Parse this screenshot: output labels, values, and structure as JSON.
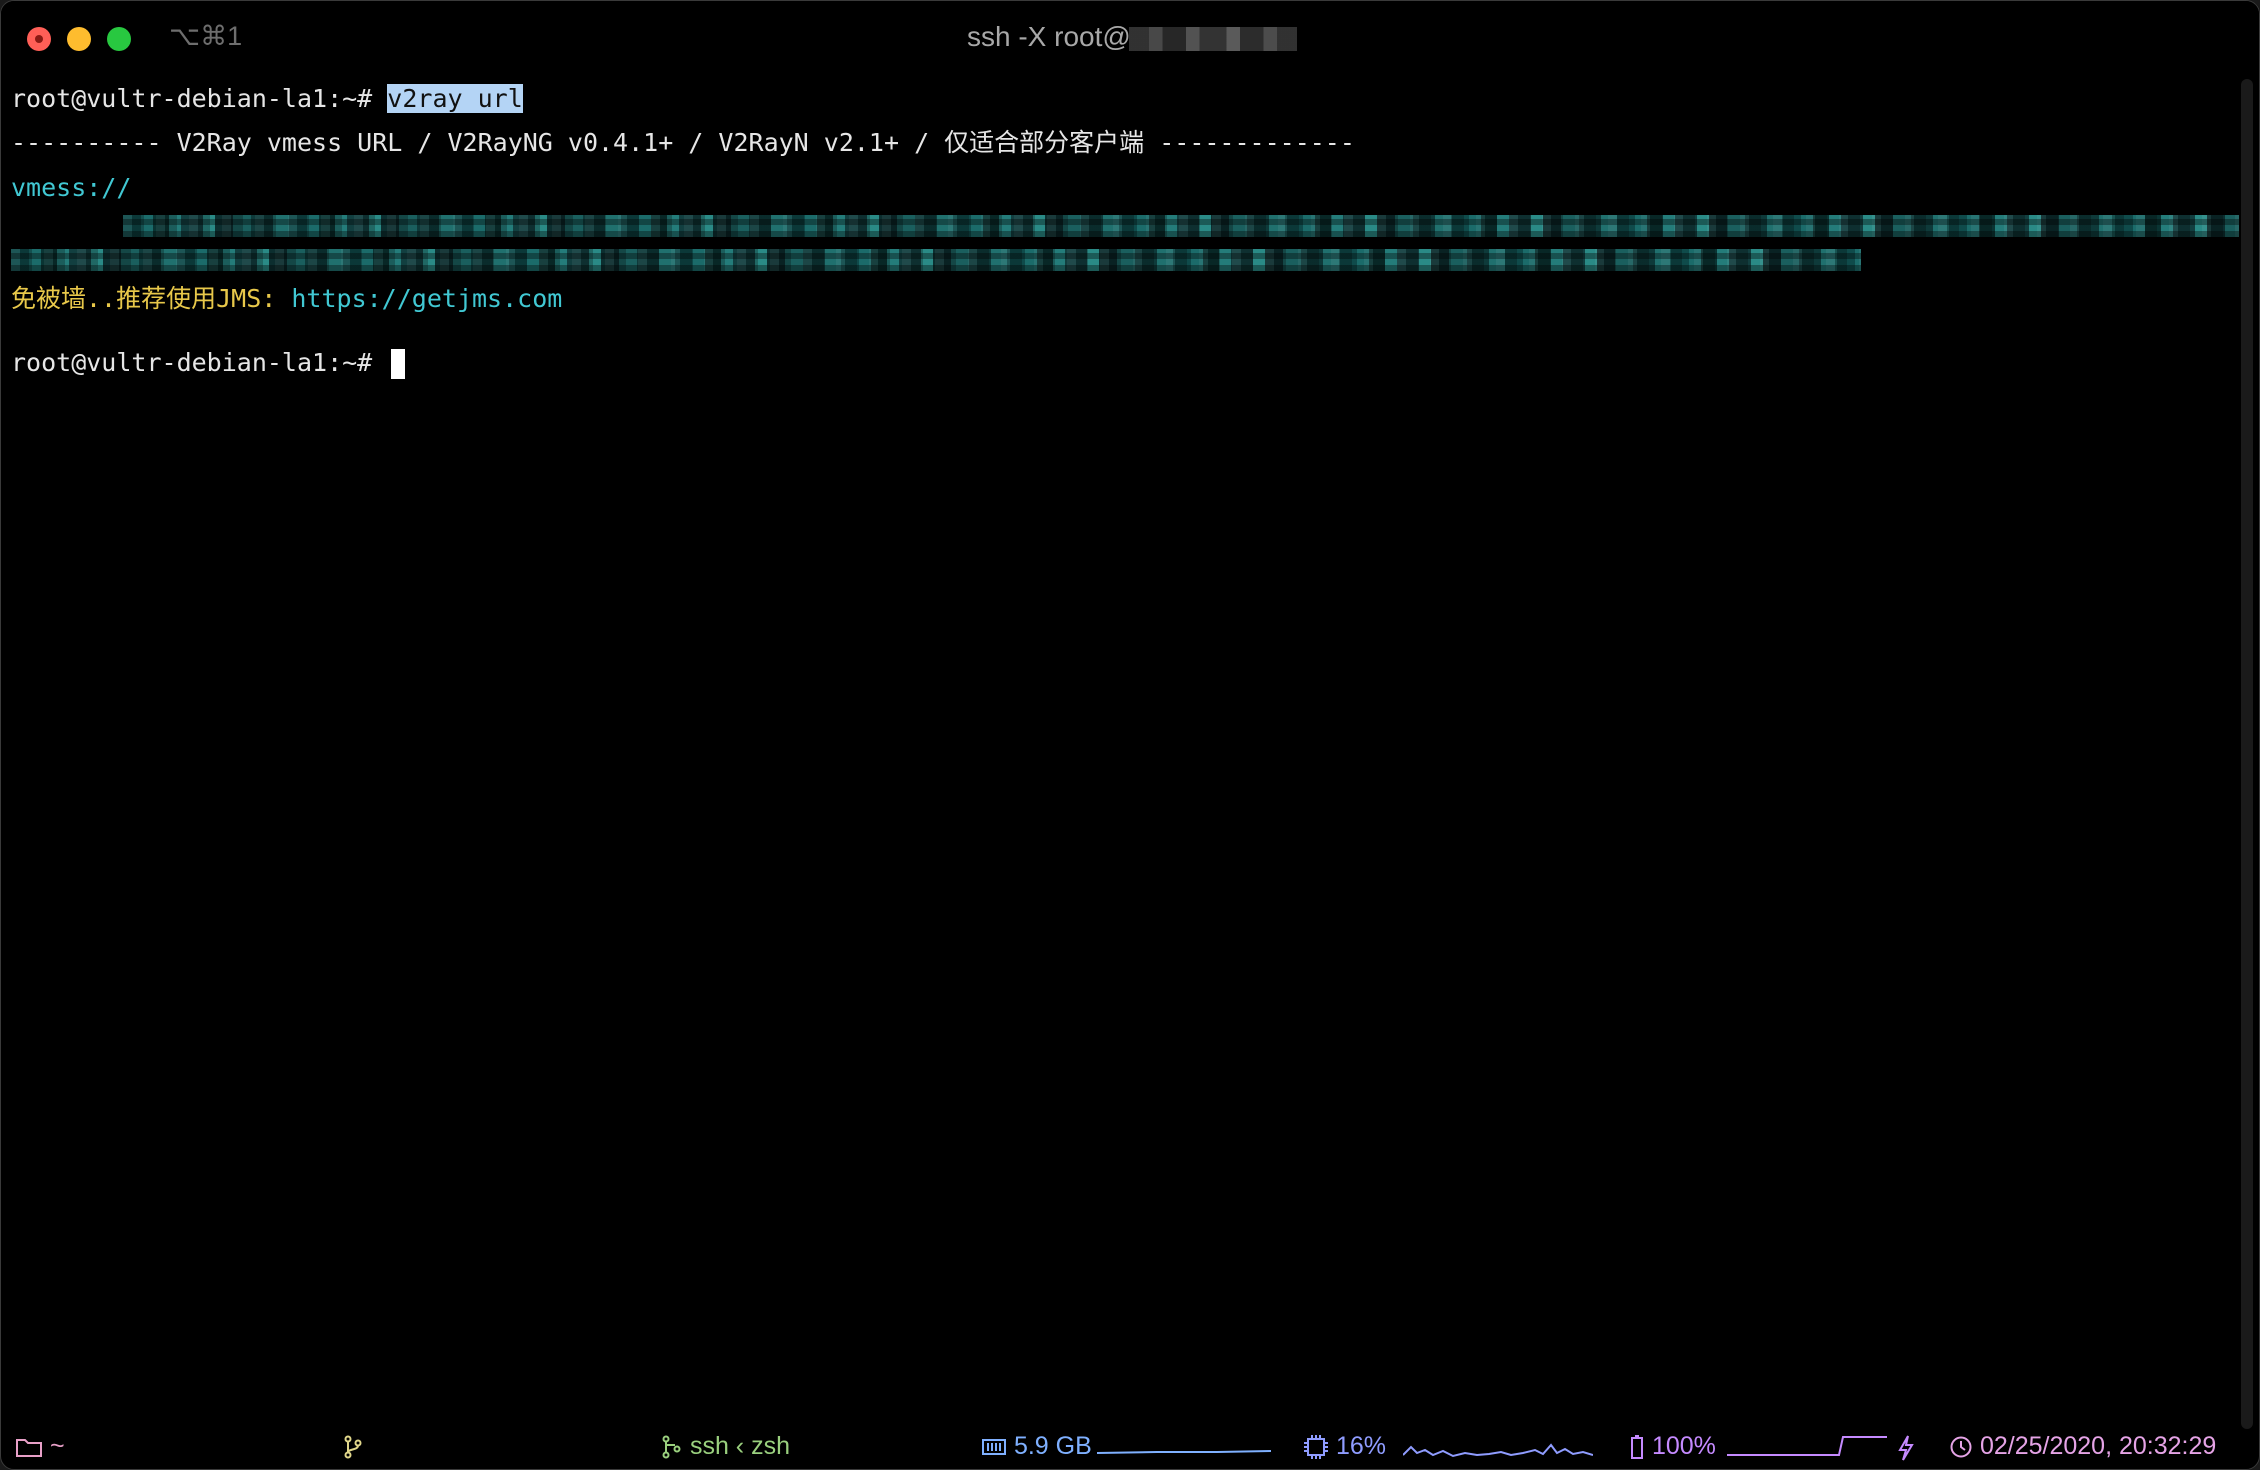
{
  "window": {
    "shortcut": "⌥⌘1",
    "title": "ssh -X root@"
  },
  "terminal": {
    "line1_prompt": "root@vultr-debian-la1:~# ",
    "line1_command": "v2ray url",
    "line2": "---------- V2Ray vmess URL / V2RayNG v0.4.1+ / V2RayN v2.1+ / 仅适合部分客户端 -------------",
    "line3_prefix": "vmess://",
    "line4_text": "免被墙..推荐使用JMS: ",
    "line4_link": "https://getjms.com",
    "line5_prompt": "root@vultr-debian-la1:~# "
  },
  "status": {
    "cwd": "~",
    "session": "ssh ‹ zsh",
    "memory": "5.9 GB",
    "cpu": "16%",
    "battery": "100%",
    "datetime": "02/25/2020, 20:32:29"
  },
  "colors": {
    "folder": "#e8a0c8",
    "git": "#e0d68a",
    "session": "#9ad07e",
    "memory": "#7fb0ff",
    "cpu": "#8f9cff",
    "battery": "#c58aff",
    "clock": "#e5a3e6"
  },
  "icons": {
    "folder": "folder-icon",
    "git": "git-branch-icon",
    "session": "session-icon",
    "memory": "memory-icon",
    "cpu": "cpu-icon",
    "battery": "battery-icon",
    "charging": "lightning-icon",
    "clock": "clock-icon"
  }
}
